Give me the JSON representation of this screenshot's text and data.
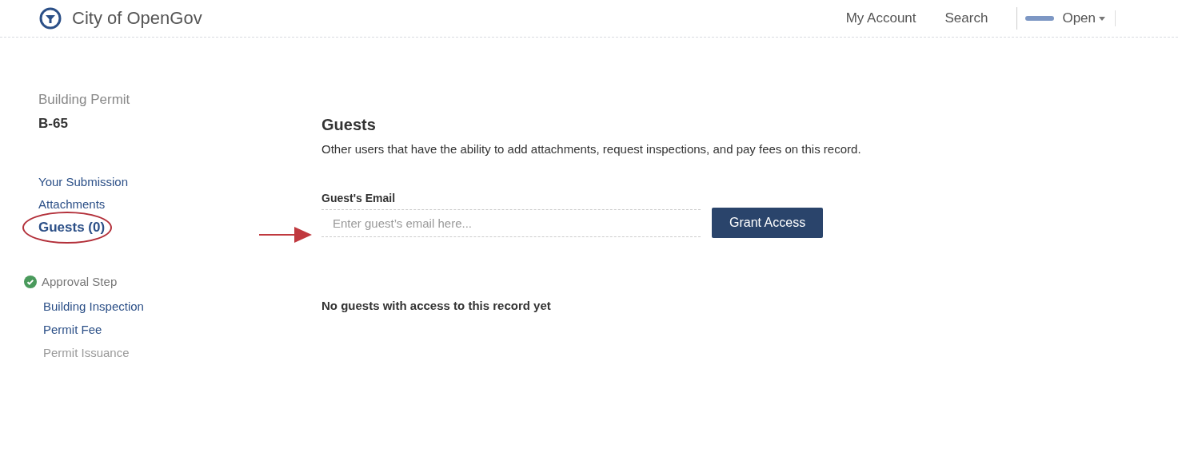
{
  "header": {
    "title": "City of OpenGov",
    "nav": [
      "My Account",
      "Search"
    ],
    "menu": "Open"
  },
  "sidebar": {
    "record_type": "Building Permit",
    "record_number": "B-65",
    "items": [
      {
        "label": "Your Submission",
        "selected": false
      },
      {
        "label": "Attachments",
        "selected": false
      },
      {
        "label": "Guests (0)",
        "selected": true
      }
    ],
    "steps": [
      {
        "label": "Approval Step",
        "complete": true,
        "children": [
          {
            "label": "Building Inspection",
            "disabled": false
          },
          {
            "label": "Permit Fee",
            "disabled": false
          },
          {
            "label": "Permit Issuance",
            "disabled": true
          }
        ]
      }
    ]
  },
  "guests": {
    "title": "Guests",
    "description": "Other users that have the ability to add attachments, request inspections, and pay fees on this record.",
    "email_label": "Guest's Email",
    "placeholder": "Enter guest’s email here...",
    "button": "Grant Access",
    "empty_message": "No guests with access to this record yet"
  }
}
